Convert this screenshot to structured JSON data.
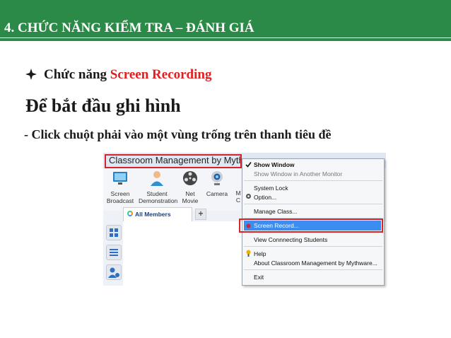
{
  "header": {
    "title": "4. CHỨC NĂNG KIỂM TRA – ĐÁNH GIÁ"
  },
  "bullet": {
    "prefix": "Chức năng ",
    "highlight": "Screen Recording",
    "icon": "diamond-bullet-icon"
  },
  "heading": "Để bắt đầu ghi hình",
  "instruction": "- Click chuột phải vào một vùng trống trên thanh tiêu đề",
  "app": {
    "title": "Classroom Management by Mythwa",
    "toolbar": [
      {
        "line1": "Screen",
        "line2": "Broadcast",
        "icon": "screen-broadcast-icon"
      },
      {
        "line1": "Student",
        "line2": "Demonstration",
        "icon": "student-demonstration-icon"
      },
      {
        "line1": "Net",
        "line2": "Movie",
        "icon": "net-movie-icon"
      },
      {
        "line1": "Camera",
        "line2": "",
        "icon": "camera-icon"
      },
      {
        "line1": "M",
        "line2": "C",
        "icon": ""
      }
    ],
    "tab_label": "All Members",
    "add_tab": "+"
  },
  "context_menu": {
    "items": [
      {
        "label": "Show Window",
        "style": "bold",
        "checked": true
      },
      {
        "label": "Show Window in Another Monitor",
        "style": "gray"
      },
      {
        "label": "System Lock"
      },
      {
        "label": "Option..."
      },
      {
        "label": "Manage Class..."
      },
      {
        "label": "Screen Record...",
        "selected": true
      },
      {
        "label": "View Connnecting Students"
      },
      {
        "label": "Help"
      },
      {
        "label": "About Classroom Management by Mythware..."
      },
      {
        "label": "Exit"
      }
    ]
  },
  "colors": {
    "header_bg": "#2b8a47",
    "highlight_red": "#e02020",
    "outline_red": "#d8232a",
    "menu_selection": "#3c8df0"
  }
}
